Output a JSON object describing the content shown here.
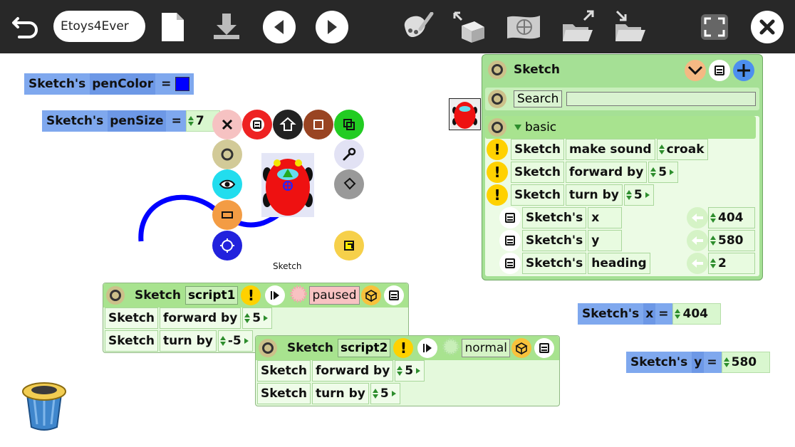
{
  "toolbar": {
    "project_name": "Etoys4Ever",
    "icons": [
      "undo-icon",
      "new-project-icon",
      "save-icon",
      "previous-icon",
      "next-icon",
      "paint-icon",
      "supplies-icon",
      "world-icon",
      "open-icon",
      "publish-icon",
      "fullscreen-icon",
      "close-icon"
    ]
  },
  "watchers": {
    "pen_color": {
      "object": "Sketch's",
      "property": "penColor",
      "eq": "=",
      "color": "#0000ff"
    },
    "pen_size": {
      "object": "Sketch's",
      "property": "penSize",
      "eq": "=",
      "value": "7"
    },
    "x": {
      "object": "Sketch's",
      "property": "x",
      "eq": "=",
      "value": "404"
    },
    "y": {
      "object": "Sketch's",
      "property": "y",
      "eq": "=",
      "value": "580"
    }
  },
  "sketch": {
    "label": "Sketch",
    "pen_color": "#0000ff"
  },
  "viewer": {
    "title": "Sketch",
    "search_label": "Search",
    "search_value": "",
    "category": "basic",
    "commands": [
      {
        "object": "Sketch",
        "command": "make sound",
        "arg": "croak"
      },
      {
        "object": "Sketch",
        "command": "forward by",
        "arg": "5"
      },
      {
        "object": "Sketch",
        "command": "turn by",
        "arg": "5"
      }
    ],
    "properties": [
      {
        "object": "Sketch's",
        "name": "x",
        "value": "404"
      },
      {
        "object": "Sketch's",
        "name": "y",
        "value": "580"
      },
      {
        "object": "Sketch's",
        "name": "heading",
        "value": "2"
      }
    ]
  },
  "script1": {
    "object": "Sketch",
    "name": "script1",
    "status": "paused",
    "lines": [
      {
        "object": "Sketch",
        "command": "forward by",
        "arg": "5"
      },
      {
        "object": "Sketch",
        "command": "turn by",
        "arg": "-5"
      }
    ]
  },
  "script2": {
    "object": "Sketch",
    "name": "script2",
    "status": "normal",
    "lines": [
      {
        "object": "Sketch",
        "command": "forward by",
        "arg": "5"
      },
      {
        "object": "Sketch",
        "command": "turn by",
        "arg": "5"
      }
    ]
  },
  "colors": {
    "toolbar": "#282828",
    "viewer": "#a5e095",
    "watcher": "#7fa8ee",
    "bang": "#ffd100"
  }
}
